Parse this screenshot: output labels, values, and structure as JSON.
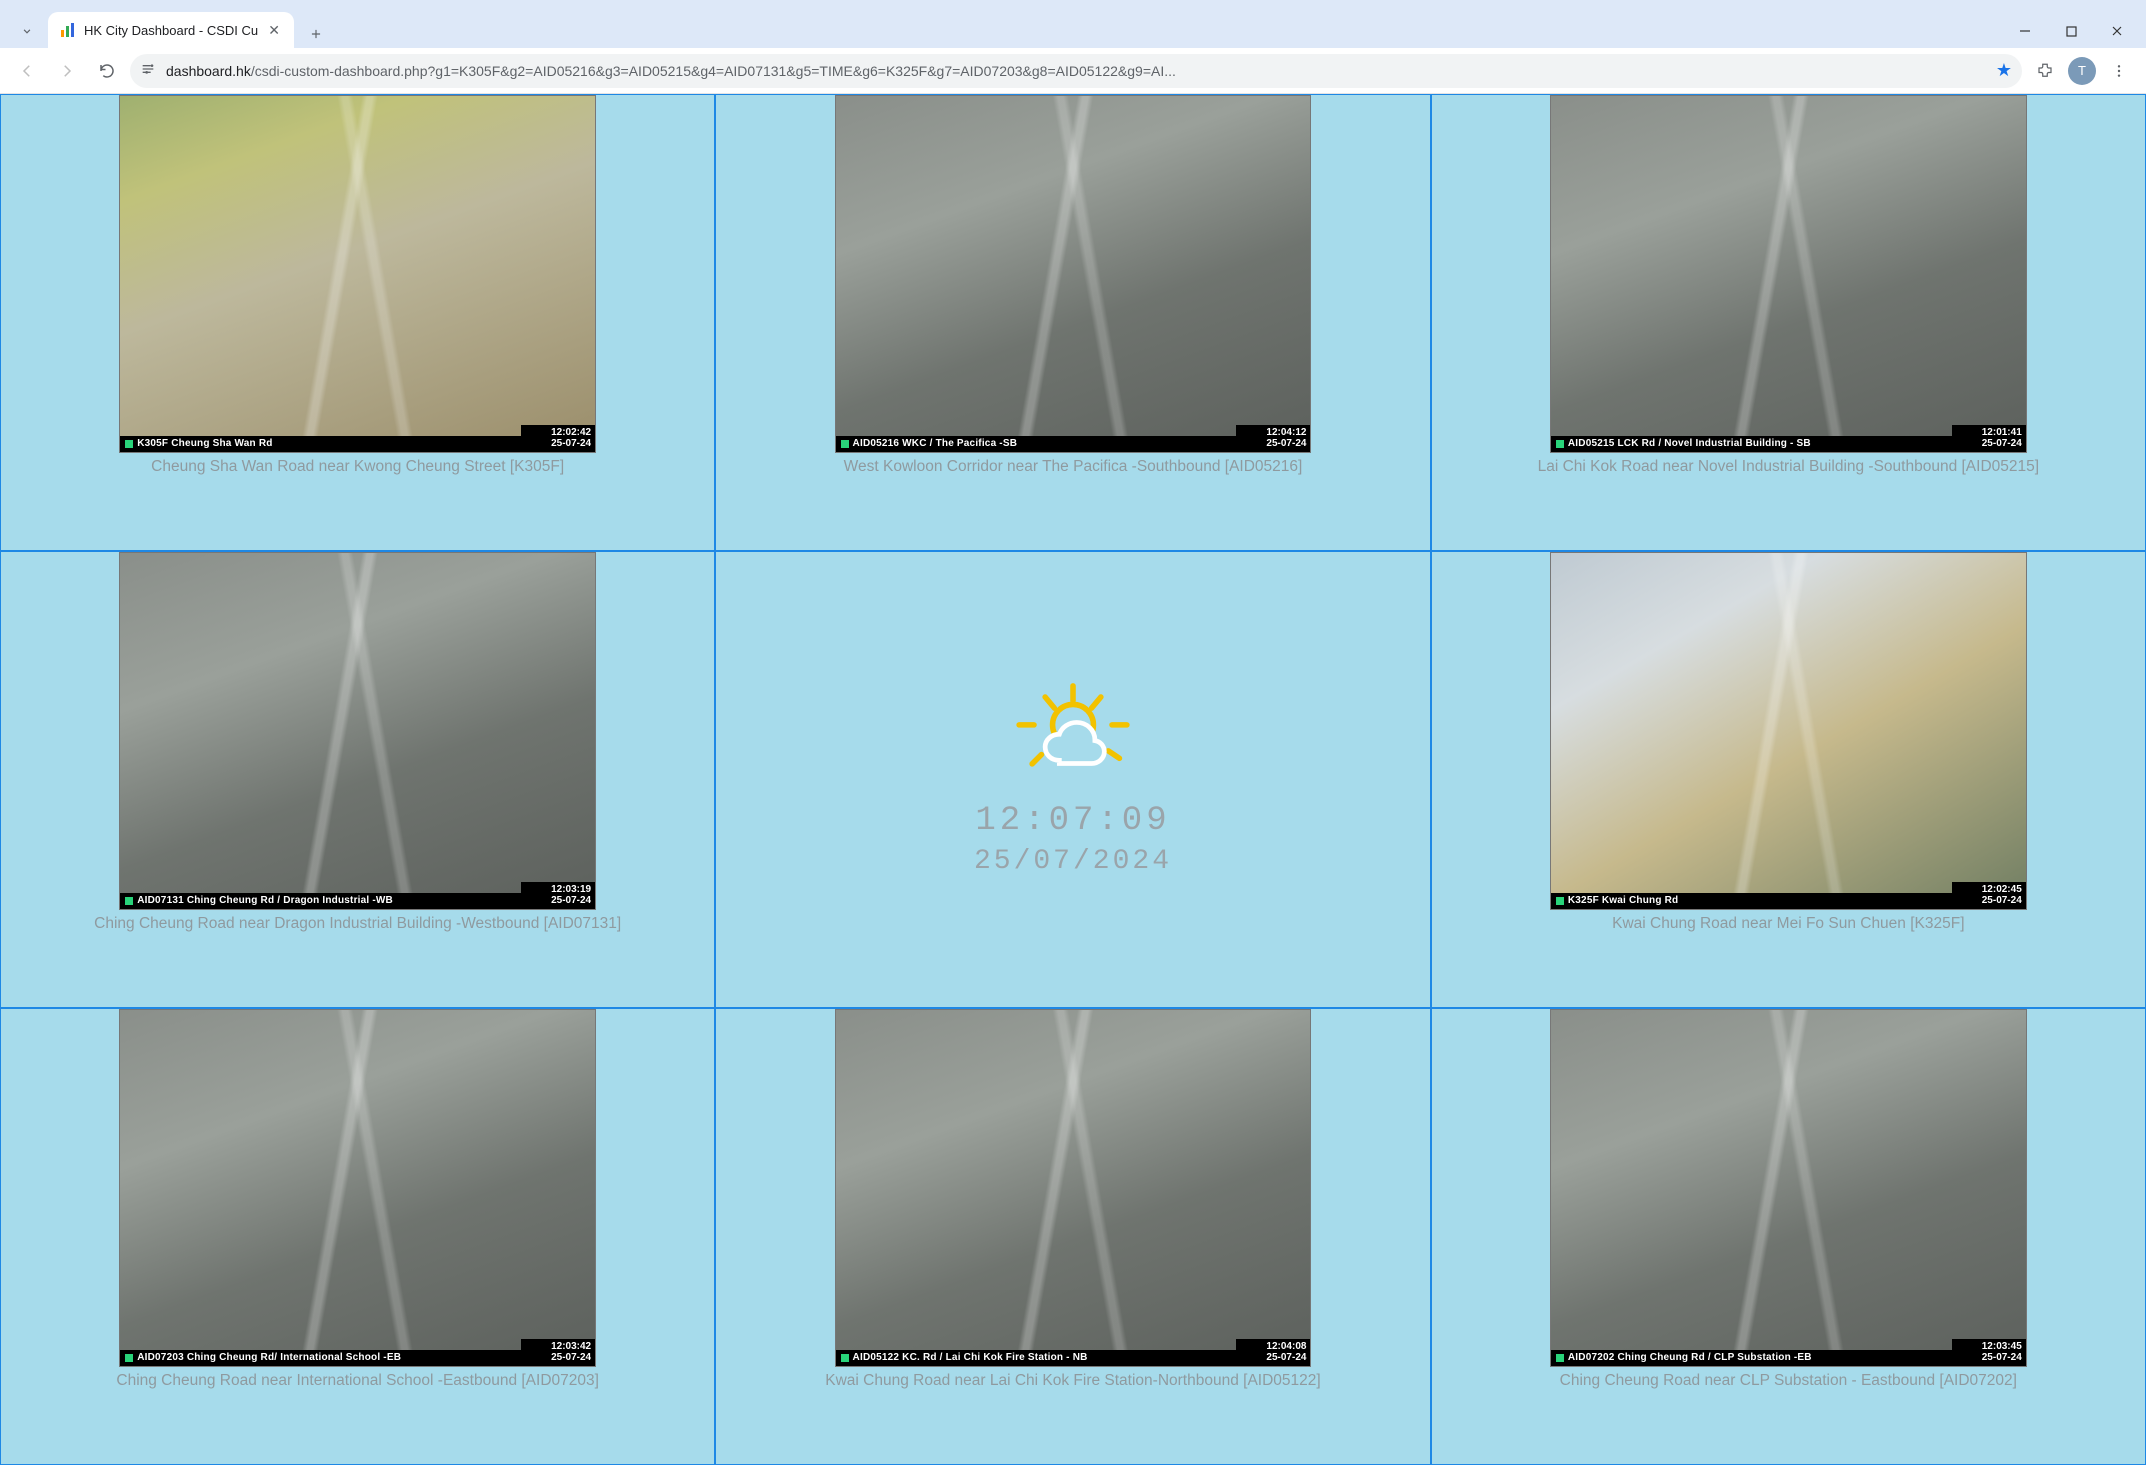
{
  "browser": {
    "tab_title": "HK City Dashboard - CSDI Cu",
    "url_host": "dashboard.hk",
    "url_path": "/csdi-custom-dashboard.php?g1=K305F&g2=AID05216&g3=AID05215&g4=AID07131&g5=TIME&g6=K325F&g7=AID07203&g8=AID05122&g9=AI...",
    "avatar_initial": "T"
  },
  "clock": {
    "time": "12:07:09",
    "date": "25/07/2024"
  },
  "cameras": [
    {
      "overlay": "K305F Cheung Sha Wan Rd",
      "time": "12:02:42",
      "date": "25-07-24",
      "caption": "Cheung Sha Wan Road near Kwong Cheung Street [K305F]",
      "style": "city"
    },
    {
      "overlay": "AID05216 WKC / The Pacifica -SB",
      "time": "12:04:12",
      "date": "25-07-24",
      "caption": "West Kowloon Corridor near The Pacifica -Southbound [AID05216]",
      "style": ""
    },
    {
      "overlay": "AID05215 LCK Rd / Novel Industrial Building - SB",
      "time": "12:01:41",
      "date": "25-07-24",
      "caption": "Lai Chi Kok Road near Novel Industrial Building -Southbound [AID05215]",
      "style": ""
    },
    {
      "overlay": "AID07131 Ching Cheung Rd / Dragon Industrial -WB",
      "time": "12:03:19",
      "date": "25-07-24",
      "caption": "Ching Cheung Road near Dragon Industrial Building -Westbound [AID07131]",
      "style": ""
    },
    {
      "overlay": "K325F Kwai Chung Rd",
      "time": "12:02:45",
      "date": "25-07-24",
      "caption": "Kwai Chung Road near Mei Fo Sun Chuen [K325F]",
      "style": "bright"
    },
    {
      "overlay": "AID07203 Ching Cheung Rd/ International School -EB",
      "time": "12:03:42",
      "date": "25-07-24",
      "caption": "Ching Cheung Road near International School -Eastbound [AID07203]",
      "style": ""
    },
    {
      "overlay": "AID05122 KC. Rd / Lai Chi Kok Fire Station - NB",
      "time": "12:04:08",
      "date": "25-07-24",
      "caption": "Kwai Chung Road near Lai Chi Kok Fire Station-Northbound [AID05122]",
      "style": ""
    },
    {
      "overlay": "AID07202 Ching Cheung Rd / CLP Substation -EB",
      "time": "12:03:45",
      "date": "25-07-24",
      "caption": "Ching Cheung Road near CLP Substation - Eastbound [AID07202]",
      "style": ""
    }
  ]
}
